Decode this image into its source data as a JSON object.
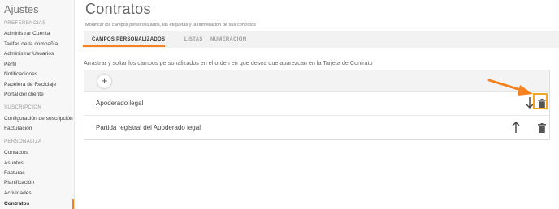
{
  "sidebar": {
    "title": "Ajustes",
    "sections": [
      {
        "heading": "PREFERENCIAS",
        "items": [
          "Administrar Cuenta",
          "Tarifas de la compañía",
          "Administrar Usuarios",
          "Perfil",
          "Notificaciones",
          "Papelera de Reciclaje",
          "Portal del cliente"
        ]
      },
      {
        "heading": "SUSCRIPCIÓN",
        "items": [
          "Configuración de suscripción",
          "Facturación"
        ]
      },
      {
        "heading": "PERSONALIZA",
        "items": [
          "Contactos",
          "Asuntos",
          "Facturas",
          "Planificación",
          "Actividades",
          "Contratos"
        ]
      }
    ],
    "active_item": "Contratos"
  },
  "header": {
    "title": "Contratos",
    "subtitle": "Modificar los campos personalizados, las etiquetas y la numeración de sus contratos"
  },
  "tabs": [
    {
      "label": "CAMPOS PERSONALIZADOS",
      "active": true
    },
    {
      "label": "LISTAS",
      "active": false
    },
    {
      "label": "NUMERACIÓN",
      "active": false
    }
  ],
  "instructions": "Arrastrar y soltar los campos personalizados en el orden en que desea que aparezcan en la Tarjeta de Contrato",
  "add_button": "+",
  "fields": [
    {
      "label": "Apoderado legal",
      "move_icon": "arrow-down-icon"
    },
    {
      "label": "Partida registral del Apoderado legal",
      "move_icon": "arrow-up-icon"
    }
  ],
  "colors": {
    "accent": "#f5821f",
    "highlight": "#f5a623"
  }
}
